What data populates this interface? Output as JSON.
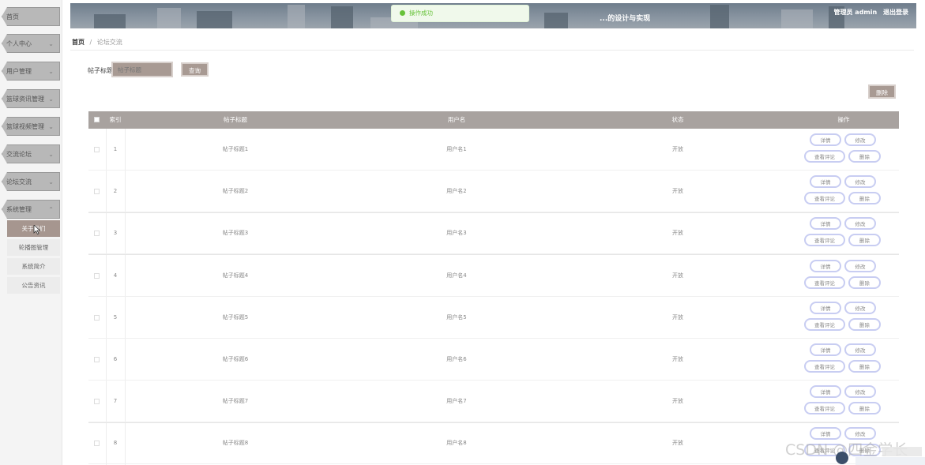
{
  "header": {
    "title": "...的设计与实现",
    "user_label": "管理员 admin",
    "logout": "退出登录"
  },
  "toast": {
    "message": "操作成功",
    "icon": "check-circle-icon"
  },
  "sidebar": {
    "items": [
      {
        "label": "首页",
        "icon": "home-icon"
      },
      {
        "label": "个人中心",
        "icon": "chevron-down-icon"
      },
      {
        "label": "用户管理",
        "icon": "chevron-down-icon"
      },
      {
        "label": "篮球资讯管理",
        "icon": "chevron-down-icon"
      },
      {
        "label": "篮球视频管理",
        "icon": "chevron-down-icon"
      },
      {
        "label": "交流论坛",
        "icon": "chevron-down-icon"
      },
      {
        "label": "论坛交流",
        "icon": "chevron-down-icon"
      },
      {
        "label": "系统管理",
        "icon": "chevron-up-icon"
      }
    ],
    "subitems": [
      {
        "label": "关于我们",
        "active": true
      },
      {
        "label": "轮播图管理",
        "active": false
      },
      {
        "label": "系统简介",
        "active": false
      },
      {
        "label": "公告资讯",
        "active": false
      }
    ]
  },
  "breadcrumb": {
    "home": "首页",
    "separator": "/",
    "current": "论坛交流"
  },
  "search": {
    "label": "帖子标题",
    "placeholder": "帖子标题",
    "button": "查询"
  },
  "toolbar": {
    "delete": "删除"
  },
  "table": {
    "columns": [
      "索引",
      "帖子标题",
      "用户名",
      "状态",
      "操作"
    ],
    "rows": [
      {
        "index": "1",
        "title": "帖子标题1",
        "username": "用户名1",
        "status": "开放"
      },
      {
        "index": "2",
        "title": "帖子标题2",
        "username": "用户名2",
        "status": "开放"
      },
      {
        "index": "3",
        "title": "帖子标题3",
        "username": "用户名3",
        "status": "开放"
      },
      {
        "index": "4",
        "title": "帖子标题4",
        "username": "用户名4",
        "status": "开放"
      },
      {
        "index": "5",
        "title": "帖子标题5",
        "username": "用户名5",
        "status": "开放"
      },
      {
        "index": "6",
        "title": "帖子标题6",
        "username": "用户名6",
        "status": "开放"
      },
      {
        "index": "7",
        "title": "帖子标题7",
        "username": "用户名7",
        "status": "开放"
      },
      {
        "index": "8",
        "title": "帖子标题8",
        "username": "用户名8",
        "status": "开放"
      }
    ],
    "actions": {
      "detail": "详情",
      "edit": "修改",
      "comment": "查看评论",
      "delete": "删除"
    }
  },
  "watermark": "CSDN @四金学长",
  "colors": {
    "accent": "#a89a93",
    "header_bg": "#a8a29f",
    "toast_green": "#67c23a",
    "pill_border": "#c8cdf2"
  }
}
